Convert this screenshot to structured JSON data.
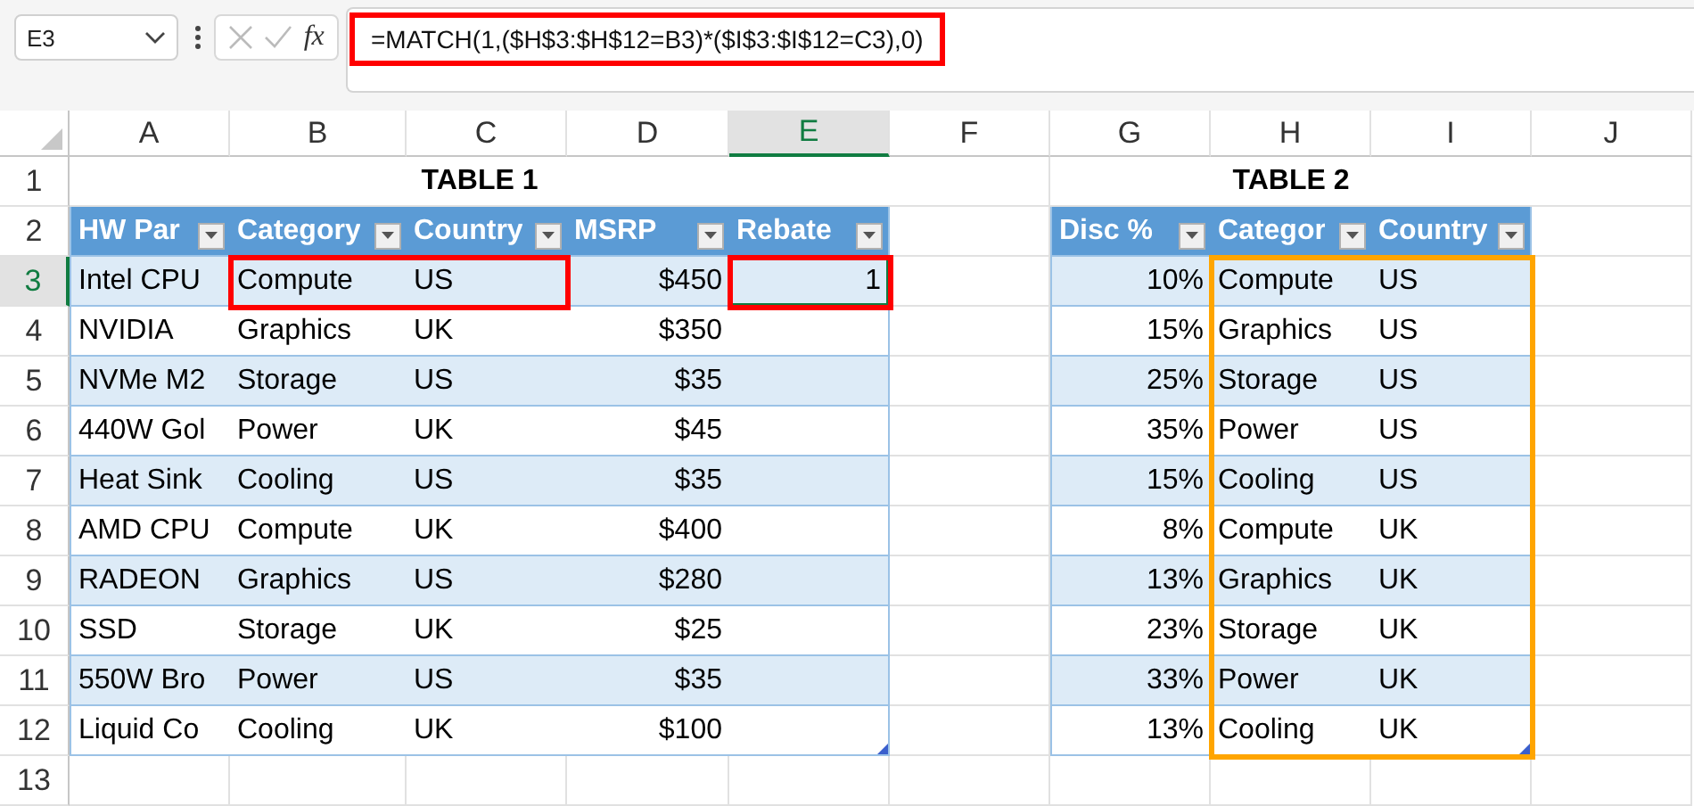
{
  "name_box": {
    "value": "E3"
  },
  "formula_bar": {
    "function_label": "fx",
    "formula": "=MATCH(1,($H$3:$H$12=B3)*($I$3:$I$12=C3),0)",
    "highlight": {
      "color": "#ff0000"
    }
  },
  "columns": [
    {
      "label": "A",
      "selected": false
    },
    {
      "label": "B",
      "selected": false
    },
    {
      "label": "C",
      "selected": false
    },
    {
      "label": "D",
      "selected": false
    },
    {
      "label": "E",
      "selected": true
    },
    {
      "label": "F",
      "selected": false
    },
    {
      "label": "G",
      "selected": false
    },
    {
      "label": "H",
      "selected": false
    },
    {
      "label": "I",
      "selected": false
    },
    {
      "label": "J",
      "selected": false
    }
  ],
  "rows": [
    {
      "label": "1",
      "selected": false
    },
    {
      "label": "2",
      "selected": false
    },
    {
      "label": "3",
      "selected": true
    },
    {
      "label": "4",
      "selected": false
    },
    {
      "label": "5",
      "selected": false
    },
    {
      "label": "6",
      "selected": false
    },
    {
      "label": "7",
      "selected": false
    },
    {
      "label": "8",
      "selected": false
    },
    {
      "label": "9",
      "selected": false
    },
    {
      "label": "10",
      "selected": false
    },
    {
      "label": "11",
      "selected": false
    },
    {
      "label": "12",
      "selected": false
    },
    {
      "label": "13",
      "selected": false
    }
  ],
  "tables": [
    {
      "title": "TABLE 1",
      "headers": [
        {
          "label": "HW Par",
          "kind": "text",
          "filter": true
        },
        {
          "label": "Category",
          "kind": "text",
          "filter": true
        },
        {
          "label": "Country",
          "kind": "text",
          "filter": true
        },
        {
          "label": "MSRP",
          "kind": "number",
          "filter": true
        },
        {
          "label": "Rebate",
          "kind": "number",
          "filter": true
        }
      ],
      "rows": [
        [
          "Intel CPU",
          "Compute",
          "US",
          "$450",
          "1"
        ],
        [
          "NVIDIA",
          "Graphics",
          "UK",
          "$350",
          ""
        ],
        [
          "NVMe M2",
          "Storage",
          "US",
          "$35",
          ""
        ],
        [
          "440W Gol",
          "Power",
          "UK",
          "$45",
          ""
        ],
        [
          "Heat Sink",
          "Cooling",
          "US",
          "$35",
          ""
        ],
        [
          "AMD CPU",
          "Compute",
          "UK",
          "$400",
          ""
        ],
        [
          "RADEON",
          "Graphics",
          "US",
          "$280",
          ""
        ],
        [
          "SSD",
          "Storage",
          "UK",
          "$25",
          ""
        ],
        [
          "550W Bro",
          "Power",
          "US",
          "$35",
          ""
        ],
        [
          "Liquid Co",
          "Cooling",
          "UK",
          "$100",
          ""
        ]
      ]
    },
    {
      "title": "TABLE 2",
      "headers": [
        {
          "label": "Disc %",
          "kind": "number",
          "filter": true
        },
        {
          "label": "Categor",
          "kind": "text",
          "filter": true
        },
        {
          "label": "Country",
          "kind": "text",
          "filter": true
        }
      ],
      "rows": [
        [
          "10%",
          "Compute",
          "US"
        ],
        [
          "15%",
          "Graphics",
          "US"
        ],
        [
          "25%",
          "Storage",
          "US"
        ],
        [
          "35%",
          "Power",
          "US"
        ],
        [
          "15%",
          "Cooling",
          "US"
        ],
        [
          "8%",
          "Compute",
          "UK"
        ],
        [
          "13%",
          "Graphics",
          "UK"
        ],
        [
          "23%",
          "Storage",
          "UK"
        ],
        [
          "33%",
          "Power",
          "UK"
        ],
        [
          "13%",
          "Cooling",
          "UK"
        ]
      ]
    }
  ],
  "highlights": [
    {
      "color": "#ff0000"
    },
    {
      "color": "#ff0000"
    },
    {
      "color": "#ffa500"
    }
  ]
}
